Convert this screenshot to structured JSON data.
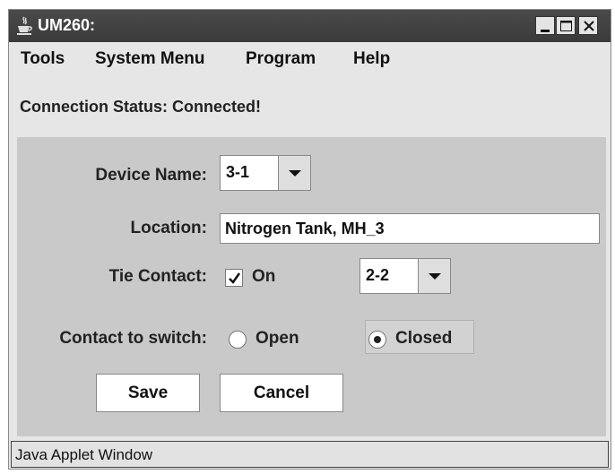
{
  "window": {
    "title": "UM260:"
  },
  "menu": [
    {
      "label": "Tools"
    },
    {
      "label": "System Menu"
    },
    {
      "label": "Program"
    },
    {
      "label": "Help"
    }
  ],
  "status_text": "Connection Status: Connected!",
  "form": {
    "device_name_label": "Device Name:",
    "device_name_value": "3-1",
    "location_label": "Location:",
    "location_value": "Nitrogen Tank, MH_3",
    "tie_contact_label": "Tie Contact:",
    "tie_contact_checkbox_label": "On",
    "tie_contact_checked": true,
    "tie_contact_value": "2-2",
    "contact_switch_label": "Contact to switch:",
    "contact_options": [
      {
        "label": "Open",
        "selected": false
      },
      {
        "label": "Closed",
        "selected": true
      }
    ]
  },
  "buttons": {
    "save": "Save",
    "cancel": "Cancel"
  },
  "footer_text": "Java Applet Window",
  "icons": {
    "app": "java-coffee-cup-icon",
    "minimize": "minimize-icon",
    "maximize": "maximize-icon",
    "close": "close-icon",
    "dropdown": "chevron-down-icon",
    "check": "check-icon"
  }
}
